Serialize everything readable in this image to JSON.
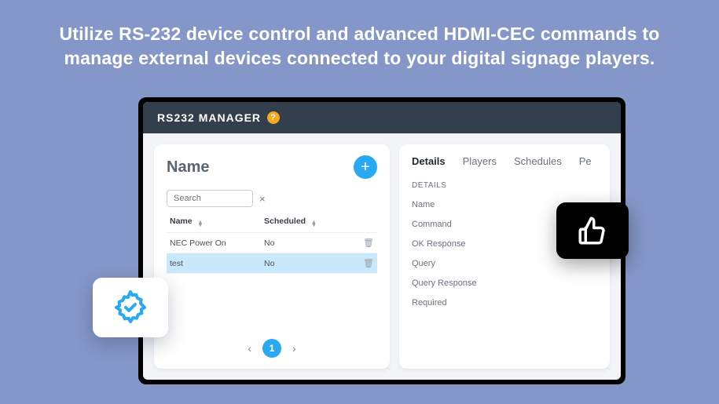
{
  "headline": "Utilize RS-232 device control and advanced HDMI-CEC commands to manage external devices connected to your digital signage players.",
  "topbar": {
    "title": "RS232 MANAGER",
    "help": "?"
  },
  "left": {
    "title": "Name",
    "search_placeholder": "Search",
    "clear": "×",
    "columns": {
      "name": "Name",
      "scheduled": "Scheduled"
    },
    "rows": [
      {
        "name": "NEC Power On",
        "scheduled": "No",
        "selected": false
      },
      {
        "name": "test",
        "scheduled": "No",
        "selected": true
      }
    ],
    "pager": {
      "prev": "‹",
      "page": "1",
      "next": "›"
    },
    "add": "+"
  },
  "right": {
    "tabs": [
      "Details",
      "Players",
      "Schedules",
      "Pe"
    ],
    "active_tab": 0,
    "heading": "DETAILS",
    "fields": [
      "Name",
      "Command",
      "OK Response",
      "Query",
      "Query Response",
      "Required"
    ]
  }
}
